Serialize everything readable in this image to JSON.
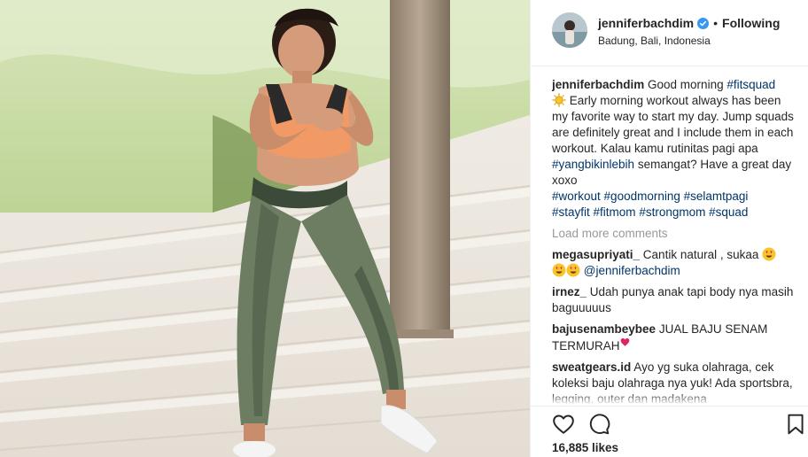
{
  "post": {
    "photo_icon": "woman-exercising-photo",
    "header": {
      "username": "jenniferbachdim",
      "dot": "•",
      "follow_label": "Following",
      "location": "Badung, Bali, Indonesia",
      "verified_icon": "verified-badge-icon"
    },
    "caption": {
      "username": "jenniferbachdim",
      "text1": " Good morning ",
      "tag1": "#fitsquad",
      "text2": " Early morning workout always has been my favorite way to start my day. Jump squads are definitely great and I include them in each workout. Kalau kamu rutinitas pagi apa ",
      "tag2": "#yangbikinlebih",
      "text3": " semangat? Have a great day xoxo",
      "hashtags": [
        "#workout",
        "#goodmorning",
        "#selamtpagi",
        "#stayfit",
        "#fitmom",
        "#strongmom",
        "#squad"
      ]
    },
    "load_more_label": "Load more comments",
    "comments": [
      {
        "username": "megasupriyati_",
        "text": " Cantik natural , sukaa ",
        "mention": "@jenniferbachdim"
      },
      {
        "username": "irnez_",
        "text": " Udah punya anak tapi body nya masih baguuuuus"
      },
      {
        "username": "bajusenambeybee",
        "text": " JUAL BAJU SENAM TERMURAH"
      },
      {
        "username": "sweatgears.id",
        "text": " Ayo yg suka olahraga, cek koleksi baju olahraga nya yuk! Ada sportsbra, legging, outer dan madakena"
      }
    ],
    "likes": "16,885 likes",
    "icons": {
      "like": "heart-icon",
      "comment": "comment-icon",
      "save": "bookmark-icon"
    },
    "colors": {
      "link": "#003569",
      "verified": "#3897f0",
      "muted": "#999999",
      "border": "#efefef"
    }
  }
}
